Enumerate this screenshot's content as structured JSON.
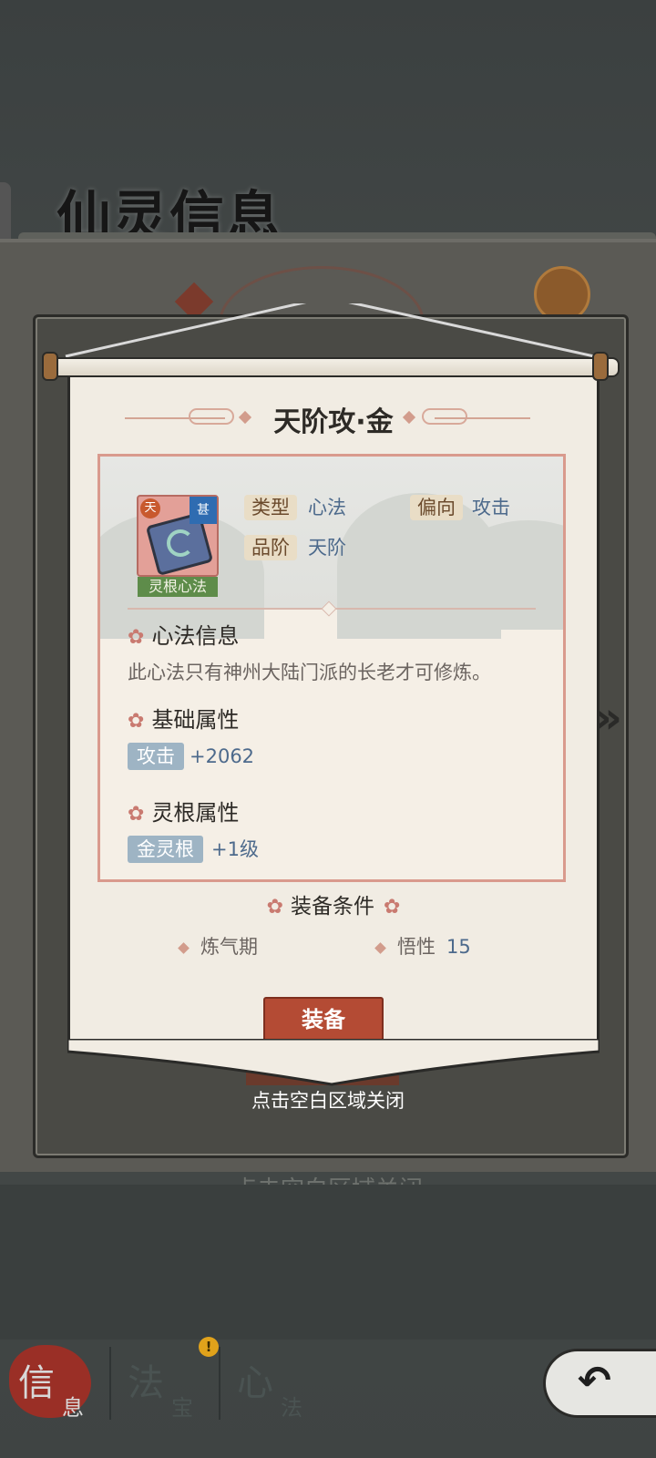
{
  "background": {
    "page_title": "仙灵信息",
    "close_hint_behind": "点击空白区域关闭"
  },
  "dialog": {
    "title": "天阶攻·金",
    "item": {
      "tier_badge": "天",
      "corner_badge": "甚",
      "tag": "灵根心法",
      "type_label": "类型",
      "type_value": "心法",
      "bias_label": "偏向",
      "bias_value": "攻击",
      "grade_label": "品阶",
      "grade_value": "天阶"
    },
    "sections": {
      "info_title": "心法信息",
      "info_desc": "此心法只有神州大陆门派的长老才可修炼。",
      "base_title": "基础属性",
      "base_attr_label": "攻击",
      "base_attr_value": "+2062",
      "root_title": "灵根属性",
      "root_attr_label": "金灵根",
      "root_attr_value": "+1级"
    },
    "conditions": {
      "title": "装备条件",
      "realm": "炼气期",
      "stat_label": "悟性",
      "stat_value": "15"
    },
    "equip_button": "装备",
    "close_hint": "点击空白区域关闭"
  },
  "tabs": [
    {
      "main": "信",
      "sub": "息"
    },
    {
      "main": "法",
      "sub": "宝"
    },
    {
      "main": "心",
      "sub": "法"
    }
  ],
  "notify_badge": "!",
  "icons": {
    "flower": "flower-icon",
    "next": "chevron-right-icon",
    "back": "back-arrow-icon"
  }
}
